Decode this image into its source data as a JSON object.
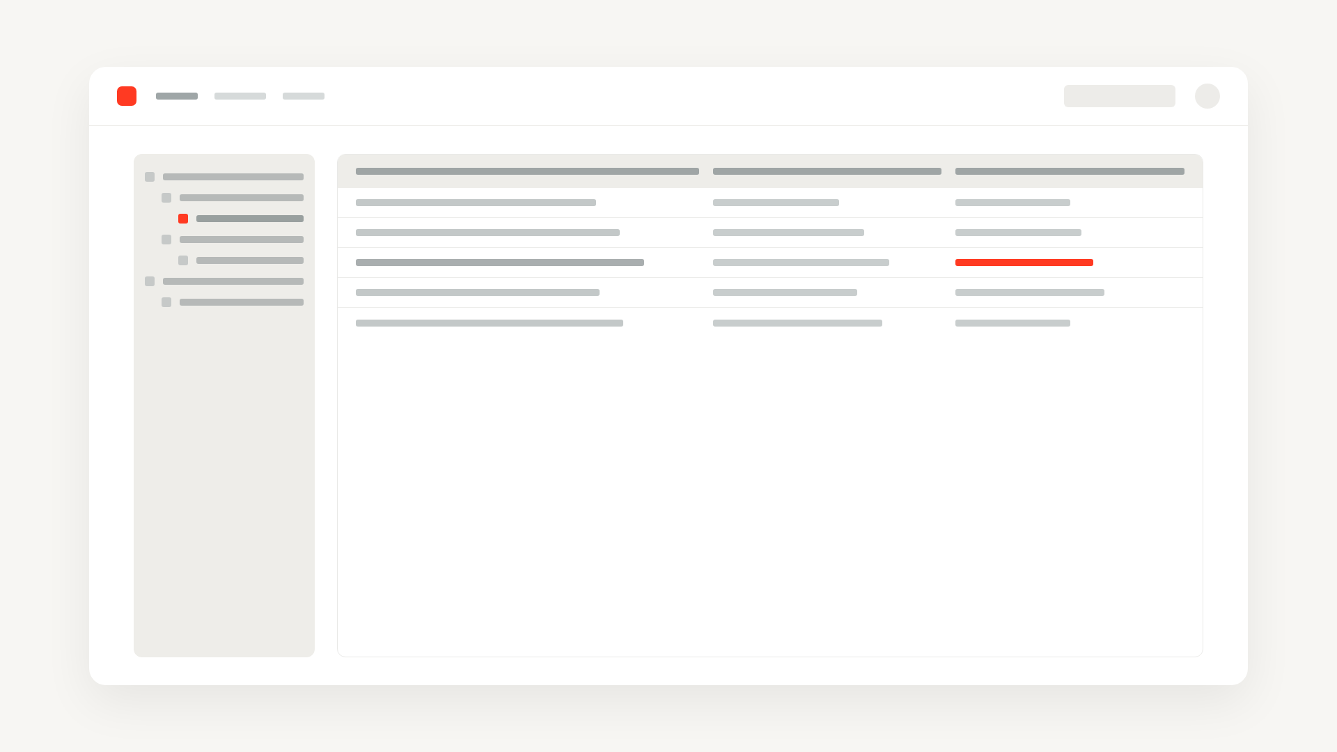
{
  "header": {
    "nav": [
      {
        "selected": true
      },
      {
        "selected": false
      },
      {
        "selected": false
      }
    ]
  },
  "sidebar": {
    "tree": [
      {
        "selected": false,
        "children": [
          {
            "selected": false,
            "children": [
              {
                "selected": true
              }
            ]
          },
          {
            "selected": false,
            "children": [
              {
                "selected": false
              }
            ]
          }
        ]
      },
      {
        "selected": false,
        "children": [
          {
            "selected": false
          }
        ]
      }
    ]
  },
  "table": {
    "rows": [
      {
        "selected": false,
        "alert": false
      },
      {
        "selected": false,
        "alert": false
      },
      {
        "selected": true,
        "alert": true
      },
      {
        "selected": false,
        "alert": false
      },
      {
        "selected": false,
        "alert": false
      }
    ]
  }
}
